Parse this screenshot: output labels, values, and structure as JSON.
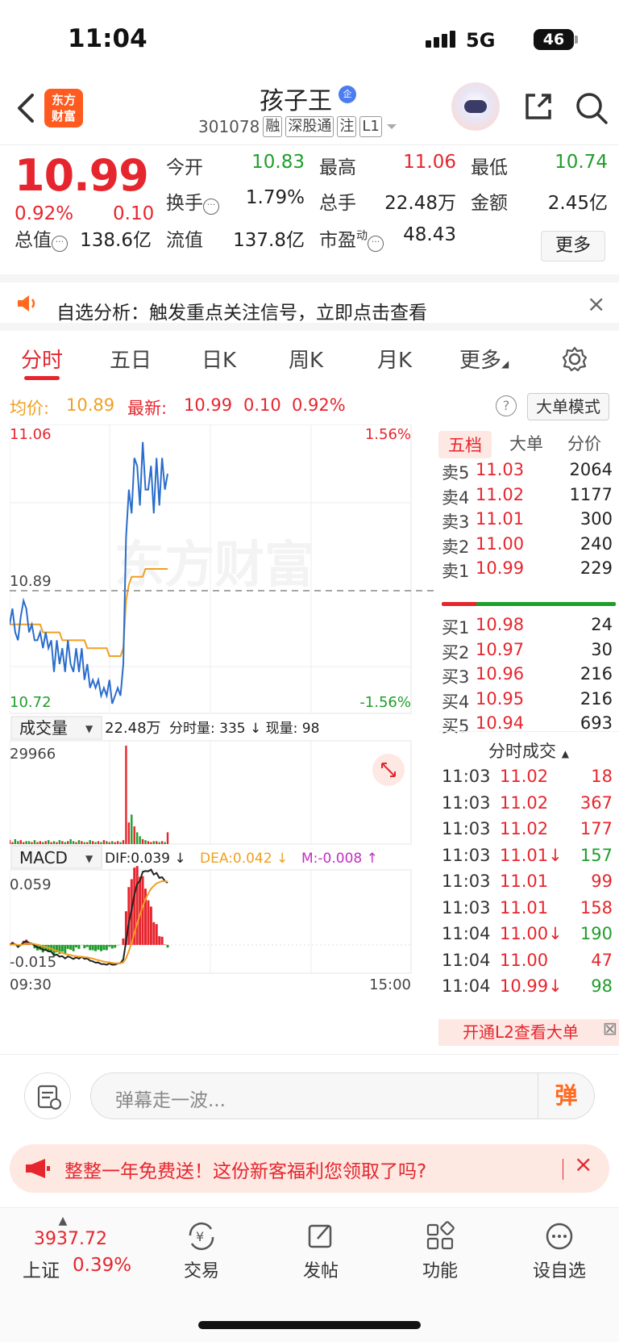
{
  "status_bar": {
    "time": "11:04",
    "network": "5G",
    "battery": "46"
  },
  "header": {
    "name": "孩子王",
    "badge": "企",
    "code": "301078",
    "tags": [
      "融",
      "深股通",
      "注",
      "L1"
    ],
    "logo_text": "东方财富"
  },
  "quote": {
    "price": "10.99",
    "change_pct": "0.92%",
    "change": "0.10",
    "fields": {
      "open_label": "今开",
      "open": "10.83",
      "high_label": "最高",
      "high": "11.06",
      "low_label": "最低",
      "low": "10.74",
      "turnover_label": "换手",
      "turnover": "1.79%",
      "volume_label": "总手",
      "volume": "22.48万",
      "amount_label": "金额",
      "amount": "2.45亿",
      "mcap_label": "总值",
      "mcap": "138.6亿",
      "float_label": "流值",
      "float": "137.8亿",
      "pe_label": "市盈",
      "pe_sup": "动",
      "pe": "48.43"
    },
    "more": "更多"
  },
  "alert": {
    "text": "自选分析：触发重点关注信号，立即点击查看"
  },
  "tabs": [
    {
      "label": "分时",
      "active": true
    },
    {
      "label": "五日"
    },
    {
      "label": "日K"
    },
    {
      "label": "周K"
    },
    {
      "label": "月K"
    },
    {
      "label": "更多"
    }
  ],
  "avg_row": {
    "avg_label": "均价:",
    "avg": "10.89",
    "latest_label": "最新:",
    "latest": "10.99",
    "chg": "0.10",
    "pct": "0.92%",
    "help": "?",
    "mode": "大单模式"
  },
  "chart_data": {
    "type": "line",
    "price_axis": {
      "top": "11.06",
      "mid": "10.89",
      "bottom": "10.72",
      "top_pct": "1.56%",
      "bottom_pct": "-1.56%"
    },
    "price_series": [
      10.82,
      10.84,
      10.81,
      10.8,
      10.83,
      10.85,
      10.84,
      10.81,
      10.82,
      10.8,
      10.8,
      10.81,
      10.79,
      10.81,
      10.79,
      10.8,
      10.76,
      10.8,
      10.77,
      10.79,
      10.76,
      10.8,
      10.77,
      10.76,
      10.79,
      10.76,
      10.79,
      10.75,
      10.77,
      10.74,
      10.75,
      10.74,
      10.75,
      10.73,
      10.74,
      10.73,
      10.75,
      10.72,
      10.73,
      10.74,
      10.73,
      10.77,
      10.93,
      10.99,
      10.96,
      11.03,
      11.02,
      10.97,
      11.05,
      10.99,
      10.99,
      11.02,
      10.96,
      11.03,
      10.97,
      11.03,
      10.99,
      11.01
    ],
    "avg_series": [
      10.82,
      10.82,
      10.82,
      10.82,
      10.82,
      10.82,
      10.82,
      10.82,
      10.82,
      10.82,
      10.82,
      10.82,
      10.81,
      10.81,
      10.81,
      10.81,
      10.81,
      10.81,
      10.81,
      10.8,
      10.8,
      10.8,
      10.8,
      10.8,
      10.8,
      10.8,
      10.8,
      10.8,
      10.79,
      10.79,
      10.79,
      10.79,
      10.79,
      10.79,
      10.79,
      10.79,
      10.78,
      10.78,
      10.78,
      10.78,
      10.78,
      10.79,
      10.85,
      10.87,
      10.88,
      10.88,
      10.88,
      10.88,
      10.88,
      10.89,
      10.89,
      10.89,
      10.89,
      10.89,
      10.89,
      10.89,
      10.89,
      10.89
    ],
    "volume_label": "成交量",
    "volume_total": "22.48万",
    "vol_readout": "分时量: 335 ↓ 现量: 98",
    "vol_max": "29966",
    "volume_bars": [
      4,
      2,
      5,
      3,
      4,
      2,
      3,
      3,
      2,
      4,
      2,
      3,
      2,
      3,
      4,
      2,
      3,
      2,
      4,
      3,
      2,
      3,
      5,
      3,
      2,
      4,
      3,
      2,
      2,
      4,
      3,
      2,
      3,
      2,
      4,
      3,
      2,
      3,
      2,
      3,
      2,
      4,
      100,
      22,
      30,
      18,
      12,
      8,
      5,
      4,
      3,
      2,
      3,
      3,
      2,
      3,
      2,
      12
    ],
    "macd_label": "MACD",
    "dif": "DIF:0.039 ↓",
    "dea": "DEA:0.042 ↓",
    "m": "M:-0.008 ↑",
    "macd_top": "0.059",
    "macd_bottom": "-0.015",
    "time_start": "09:30",
    "time_end": "15:00"
  },
  "order_book": {
    "tabs": [
      "五档",
      "大单",
      "分价"
    ],
    "asks": [
      {
        "label": "卖5",
        "price": "11.03",
        "vol": "2064"
      },
      {
        "label": "卖4",
        "price": "11.02",
        "vol": "1177"
      },
      {
        "label": "卖3",
        "price": "11.01",
        "vol": "300"
      },
      {
        "label": "卖2",
        "price": "11.00",
        "vol": "240"
      },
      {
        "label": "卖1",
        "price": "10.99",
        "vol": "229"
      }
    ],
    "bids": [
      {
        "label": "买1",
        "price": "10.98",
        "vol": "24"
      },
      {
        "label": "买2",
        "price": "10.97",
        "vol": "30"
      },
      {
        "label": "买3",
        "price": "10.96",
        "vol": "216"
      },
      {
        "label": "买4",
        "price": "10.95",
        "vol": "216"
      },
      {
        "label": "买5",
        "price": "10.94",
        "vol": "693"
      }
    ],
    "ticks_title": "分时成交",
    "ticks": [
      {
        "t": "11:03",
        "p": "11.02",
        "v": "18",
        "dir": "up"
      },
      {
        "t": "11:03",
        "p": "11.02",
        "v": "367",
        "dir": "up"
      },
      {
        "t": "11:03",
        "p": "11.02",
        "v": "177",
        "dir": "up"
      },
      {
        "t": "11:03",
        "p": "11.01↓",
        "v": "157",
        "dir": "down"
      },
      {
        "t": "11:03",
        "p": "11.01",
        "v": "99",
        "dir": "up"
      },
      {
        "t": "11:03",
        "p": "11.01",
        "v": "158",
        "dir": "up"
      },
      {
        "t": "11:04",
        "p": "11.00↓",
        "v": "190",
        "dir": "down"
      },
      {
        "t": "11:04",
        "p": "11.00",
        "v": "47",
        "dir": "up"
      },
      {
        "t": "11:04",
        "p": "10.99↓",
        "v": "98",
        "dir": "down"
      }
    ],
    "l2": "开通L2查看大单"
  },
  "danmu": {
    "placeholder": "弹幕走一波...",
    "btn": "弹"
  },
  "promo": {
    "text": "整整一年免费送！这份新客福利您领取了吗?"
  },
  "bottom_nav": {
    "index_value": "3937.72",
    "index_name": "上证",
    "index_pct": "0.39%",
    "items": [
      "交易",
      "发帖",
      "功能",
      "设自选"
    ]
  }
}
